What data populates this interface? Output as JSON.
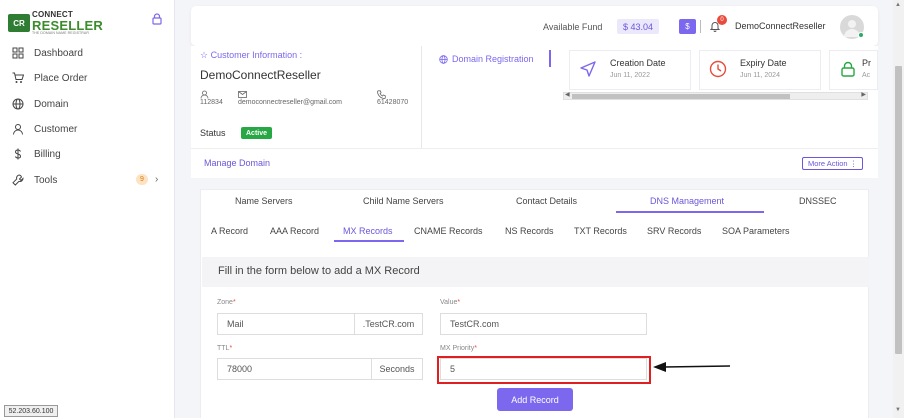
{
  "sidebar": {
    "logo": {
      "mark": "CR",
      "line1": "CONNECT",
      "line2": "RESELLER",
      "line3": "THE DOMAIN NAME REGISTRAR"
    },
    "items": [
      {
        "label": "Dashboard",
        "icon": "grid-icon"
      },
      {
        "label": "Place Order",
        "icon": "cart-icon"
      },
      {
        "label": "Domain",
        "icon": "globe-icon"
      },
      {
        "label": "Customer",
        "icon": "user-icon"
      },
      {
        "label": "Billing",
        "icon": "dollar-icon"
      },
      {
        "label": "Tools",
        "icon": "wrench-icon",
        "badge": "9"
      }
    ]
  },
  "status_ip": "52.203.60.100",
  "topbar": {
    "fund_label": "Available Fund",
    "fund_value": "$ 43.04",
    "dollar_button": "$",
    "notification_count": "0",
    "user_name": "DemoConnectReseller"
  },
  "customer": {
    "section_title": "Customer Information :",
    "name": "DemoConnectReseller",
    "id": "112834",
    "email": "democonnectreseller@gmail.com",
    "phone": "61428070",
    "status_label": "Status",
    "status_value": "Active"
  },
  "domain_registration": {
    "label": "Domain Registration",
    "cards": [
      {
        "title": "Creation Date",
        "date": "Jun 11, 2022",
        "color": "#7b68ee"
      },
      {
        "title": "Expiry Date",
        "date": "Jun 11, 2024",
        "color": "#e74c3c"
      },
      {
        "title": "Pr",
        "date": "Ac",
        "color": "#28a745"
      }
    ]
  },
  "manage": {
    "link": "Manage Domain",
    "more_action": "More Action ⋮"
  },
  "tabs": [
    {
      "label": "Name Servers"
    },
    {
      "label": "Child Name Servers"
    },
    {
      "label": "Contact Details"
    },
    {
      "label": "DNS Management",
      "active": true
    },
    {
      "label": "DNSSEC"
    }
  ],
  "subtabs": [
    {
      "label": "A Record"
    },
    {
      "label": "AAA Record"
    },
    {
      "label": "MX Records",
      "active": true
    },
    {
      "label": "CNAME Records"
    },
    {
      "label": "NS Records"
    },
    {
      "label": "TXT Records"
    },
    {
      "label": "SRV Records"
    },
    {
      "label": "SOA Parameters"
    }
  ],
  "form": {
    "title": "Fill in the form below to add a MX Record",
    "zone_label": "Zone",
    "zone_value": "Mail",
    "zone_suffix": ".TestCR.com",
    "value_label": "Value",
    "value_value": "TestCR.com",
    "ttl_label": "TTL",
    "ttl_value": "78000",
    "ttl_unit": "Seconds",
    "priority_label": "MX Priority",
    "priority_value": "5",
    "required_mark": "*",
    "submit": "Add Record"
  }
}
